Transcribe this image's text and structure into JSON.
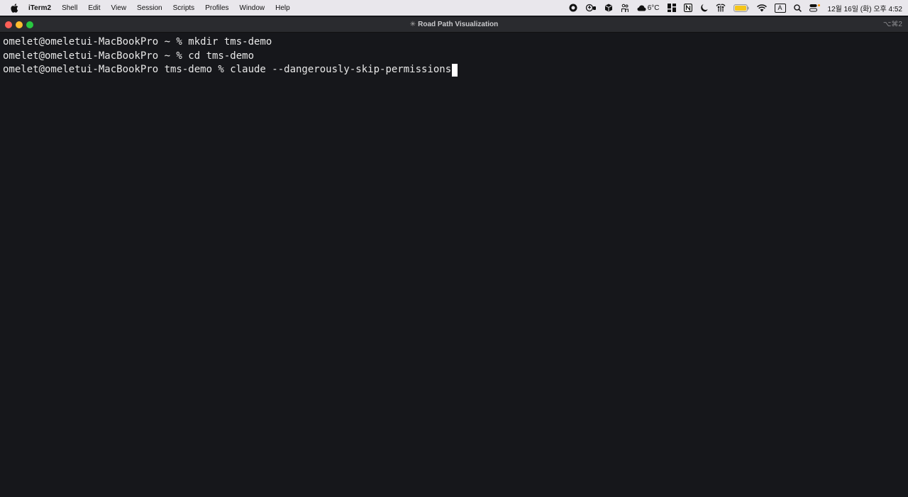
{
  "menubar": {
    "app_name": "iTerm2",
    "items": [
      "Shell",
      "Edit",
      "View",
      "Session",
      "Scripts",
      "Profiles",
      "Window",
      "Help"
    ],
    "weather": "6°C",
    "input_source": "A",
    "clock": "12월 16일 (화) 오후 4:52",
    "icons": [
      "record-icon",
      "accessibility-icon",
      "package-icon",
      "people-icon",
      "weather-icon",
      "app-grid-icon",
      "notion-icon",
      "moon-icon",
      "airdrop-icon",
      "battery-icon",
      "wifi-icon",
      "input-source-icon",
      "search-icon",
      "control-center-icon"
    ],
    "colors": {
      "battery": "#f5c518"
    }
  },
  "window": {
    "title": "Road Path Visualization",
    "title_prefix_glyph": "✳",
    "shortcut": "⌥⌘2"
  },
  "terminal": {
    "lines": [
      "omelet@omeletui-MacBookPro ~ % mkdir tms-demo",
      "omelet@omeletui-MacBookPro ~ % cd tms-demo",
      "omelet@omeletui-MacBookPro tms-demo % claude --dangerously-skip-permissions"
    ]
  }
}
